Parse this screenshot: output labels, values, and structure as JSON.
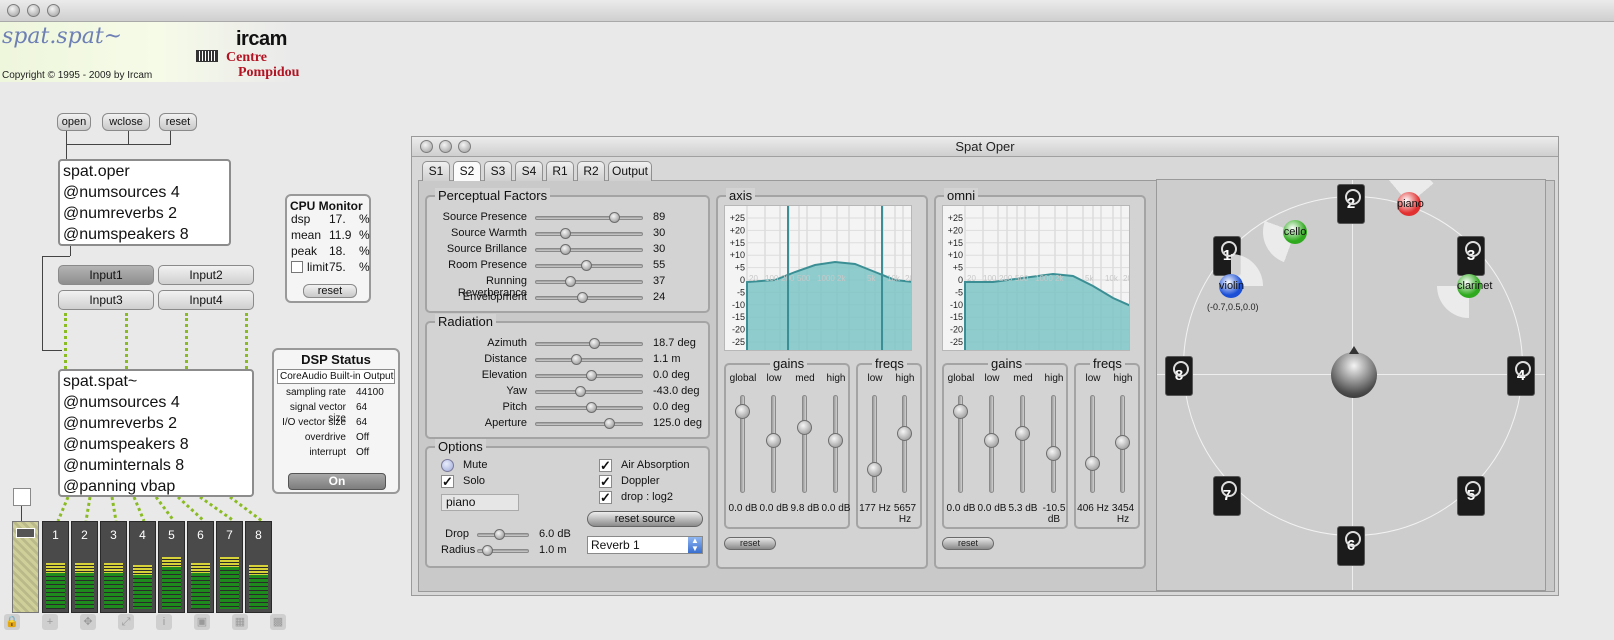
{
  "window": {
    "title": "Spat Oper"
  },
  "header": {
    "app_name": "spat.spat~",
    "copyright": "Copyright © 1995 - 2009 by Ircam",
    "logo_top": "ircam",
    "logo_bottom_1": "Centre",
    "logo_bottom_2": "Pompidou"
  },
  "patcher": {
    "messages": [
      "open",
      "wclose",
      "reset"
    ],
    "oper_box": "spat.oper\n@numsources 4\n@numreverbs 2\n@numspeakers 8",
    "inputs": [
      "Input1",
      "Input2",
      "Input3",
      "Input4"
    ],
    "spat_box": "spat.spat~\n@numsources 4\n@numreverbs 2\n@numspeakers 8\n@numinternals 8\n@panning vbap",
    "meters": [
      "1",
      "2",
      "3",
      "4",
      "5",
      "6",
      "7",
      "8"
    ]
  },
  "cpu": {
    "title": "CPU Monitor",
    "rows": [
      {
        "label": "dsp",
        "value": "17.",
        "unit": "%"
      },
      {
        "label": "mean",
        "value": "11.9",
        "unit": "%"
      },
      {
        "label": "peak",
        "value": "18.",
        "unit": "%"
      },
      {
        "label": "limit",
        "value": "75.",
        "unit": "%"
      }
    ],
    "reset": "reset"
  },
  "dsp": {
    "title": "DSP Status",
    "device": "CoreAudio Built-in Output",
    "rows": [
      {
        "label": "sampling rate",
        "value": "44100"
      },
      {
        "label": "signal vector size",
        "value": "64"
      },
      {
        "label": "I/O vector size",
        "value": "64"
      },
      {
        "label": "overdrive",
        "value": "Off"
      },
      {
        "label": "interrupt",
        "value": "Off"
      }
    ],
    "toggle": "On"
  },
  "tabs": [
    "S1",
    "S2",
    "S3",
    "S4",
    "R1",
    "R2",
    "Output"
  ],
  "active_tab": "S2",
  "perceptual": {
    "title": "Perceptual Factors",
    "rows": [
      {
        "label": "Source Presence",
        "value": "89"
      },
      {
        "label": "Source Warmth",
        "value": "30"
      },
      {
        "label": "Source Brillance",
        "value": "30"
      },
      {
        "label": "Room Presence",
        "value": "55"
      },
      {
        "label": "Running Reverberance",
        "value": "37"
      },
      {
        "label": "Envelopment",
        "value": "24"
      }
    ]
  },
  "radiation": {
    "title": "Radiation",
    "rows": [
      {
        "label": "Azimuth",
        "value": "18.7 deg"
      },
      {
        "label": "Distance",
        "value": "1.1 m"
      },
      {
        "label": "Elevation",
        "value": "0.0 deg"
      },
      {
        "label": "Yaw",
        "value": "-43.0 deg"
      },
      {
        "label": "Pitch",
        "value": "0.0 deg"
      },
      {
        "label": "Aperture",
        "value": "125.0 deg"
      }
    ]
  },
  "options": {
    "title": "Options",
    "mute": "Mute",
    "solo": "Solo",
    "air": "Air Absorption",
    "doppler": "Doppler",
    "drop_log": "drop : log2",
    "source_name": "piano",
    "reset_source": "reset source",
    "drop_label": "Drop",
    "drop_value": "6.0 dB",
    "radius_label": "Radius",
    "radius_value": "1.0 m",
    "reverb_select": "Reverb 1"
  },
  "axis": {
    "title": "axis",
    "gains_title": "gains",
    "freqs_title": "freqs",
    "db_ticks": [
      "+25",
      "+20",
      "+15",
      "+10",
      "+5",
      "0",
      "-5",
      "-10",
      "-15",
      "-20",
      "-25"
    ],
    "freq_ticks": [
      "20",
      "100",
      "200",
      "500",
      "1000",
      "2k",
      "5k",
      "10k",
      "20"
    ],
    "gain_cols": [
      {
        "label": "global",
        "value": "0.0 dB"
      },
      {
        "label": "low",
        "value": "0.0 dB"
      },
      {
        "label": "med",
        "value": "9.8 dB"
      },
      {
        "label": "high",
        "value": "0.0 dB"
      }
    ],
    "freq_cols": [
      {
        "label": "low",
        "value": "177 Hz"
      },
      {
        "label": "high",
        "value": "5657 Hz"
      }
    ],
    "reset": "reset"
  },
  "omni": {
    "title": "omni",
    "gains_title": "gains",
    "freqs_title": "freqs",
    "db_ticks": [
      "+25",
      "+20",
      "+15",
      "+10",
      "+5",
      "0",
      "-5",
      "-10",
      "-15",
      "-20",
      "-25"
    ],
    "freq_ticks": [
      "20",
      "100",
      "200",
      "500",
      "1000",
      "2k",
      "5k",
      "10k",
      "20"
    ],
    "gain_cols": [
      {
        "label": "global",
        "value": "0.0 dB"
      },
      {
        "label": "low",
        "value": "0.0 dB"
      },
      {
        "label": "med",
        "value": "5.3 dB"
      },
      {
        "label": "high",
        "value": "-10.5 dB"
      }
    ],
    "freq_cols": [
      {
        "label": "low",
        "value": "406 Hz"
      },
      {
        "label": "high",
        "value": "3454 Hz"
      }
    ],
    "reset": "reset"
  },
  "map": {
    "speakers": [
      "1",
      "2",
      "3",
      "4",
      "5",
      "6",
      "7",
      "8"
    ],
    "sources": [
      {
        "name": "violin",
        "color": "#1a4fd6"
      },
      {
        "name": "cello",
        "color": "#2faa1e"
      },
      {
        "name": "piano",
        "color": "#e23030"
      },
      {
        "name": "clarinet",
        "color": "#2faa1e"
      }
    ],
    "violin_coord": "(-0.7,0.5,0.0)"
  },
  "toolbar_icons": [
    "lock-icon",
    "plus-icon",
    "move-icon",
    "presentation-icon",
    "info-icon",
    "grid-a-icon",
    "grid-b-icon",
    "grid-c-icon"
  ]
}
